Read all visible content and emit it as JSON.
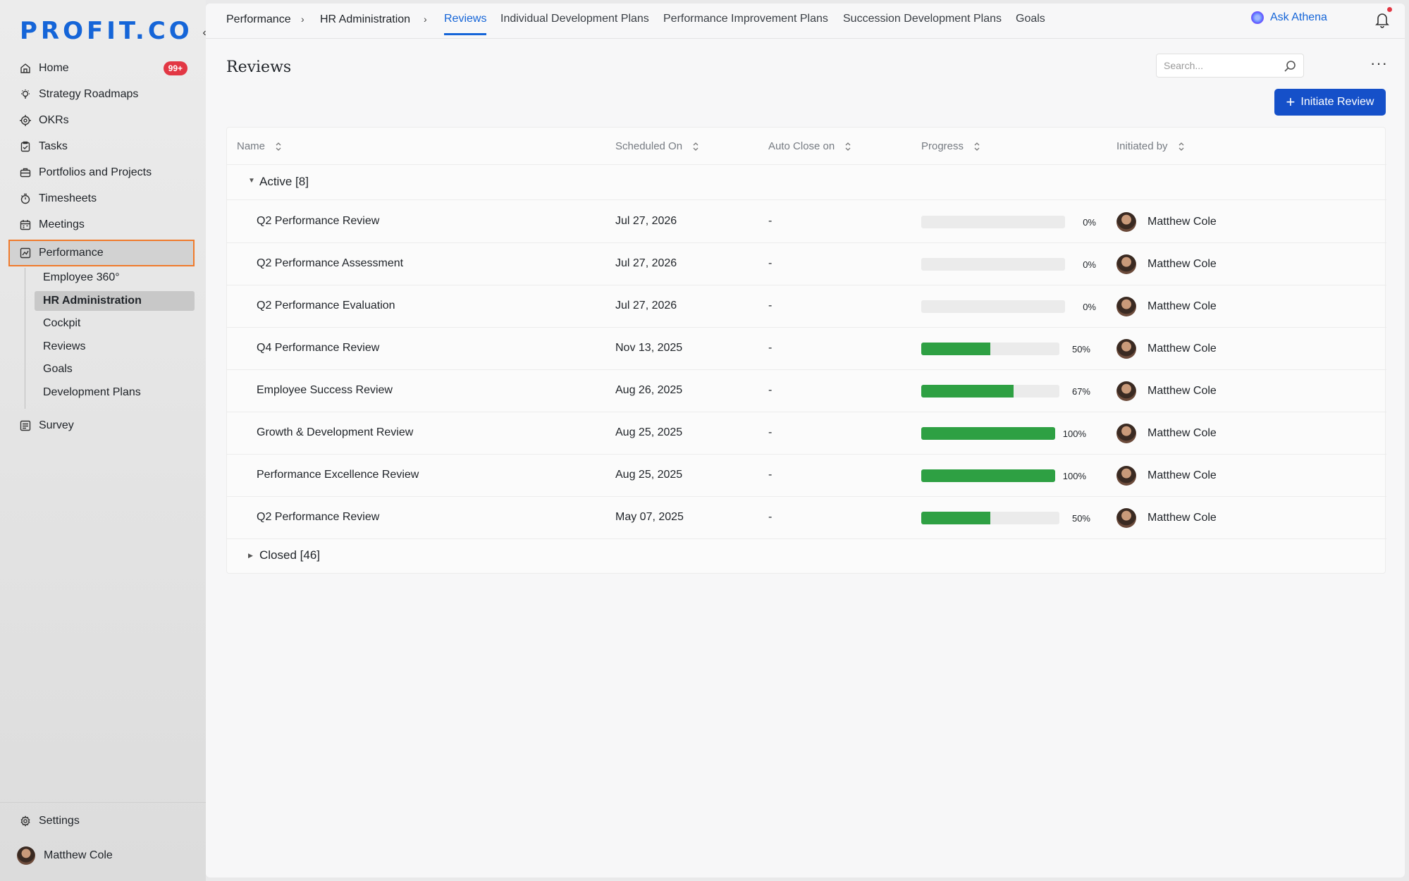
{
  "brand": {
    "logo_text": "PROFIT.CO"
  },
  "sidebar": {
    "collapse_label": "‹",
    "items": [
      {
        "label": "Home",
        "icon": "home-icon",
        "badge": "99+"
      },
      {
        "label": "Strategy Roadmaps",
        "icon": "lightbulb-icon"
      },
      {
        "label": "OKRs",
        "icon": "target-icon"
      },
      {
        "label": "Tasks",
        "icon": "clipboard-check-icon"
      },
      {
        "label": "Portfolios and Projects",
        "icon": "briefcase-icon"
      },
      {
        "label": "Timesheets",
        "icon": "stopwatch-icon"
      },
      {
        "label": "Meetings",
        "icon": "calendar-icon"
      },
      {
        "label": "Performance",
        "icon": "chart-line-icon"
      },
      {
        "label": "Survey",
        "icon": "survey-icon"
      }
    ],
    "performance_sub": [
      {
        "label": "Employee 360°"
      },
      {
        "label": "HR Administration"
      },
      {
        "label": "Cockpit"
      },
      {
        "label": "Reviews"
      },
      {
        "label": "Goals"
      },
      {
        "label": "Development Plans"
      }
    ],
    "settings_label": "Settings",
    "user_name": "Matthew Cole"
  },
  "topbar": {
    "breadcrumb": [
      "Performance",
      "HR Administration"
    ],
    "breadcrumb_sep": "›",
    "tabs": [
      "Reviews",
      "Individual Development Plans",
      "Performance Improvement Plans",
      "Succession Development Plans",
      "Goals"
    ],
    "active_tab": "Reviews",
    "ask_label": "Ask Athena"
  },
  "page": {
    "title": "Reviews",
    "search_placeholder": "Search...",
    "more_label": "···",
    "primary_button": "Initiate Review"
  },
  "table": {
    "columns": [
      "Name",
      "Scheduled On",
      "Auto Close on",
      "Progress",
      "Initiated by"
    ],
    "groups": {
      "active_label": "Active",
      "active_count": "[8]",
      "closed_label": "Closed",
      "closed_count": "[46]"
    },
    "rows": [
      {
        "name": "Q2 Performance Review",
        "scheduled": "Jul 27, 2026",
        "auto_close": "-",
        "progress": 0,
        "progress_text": "0%",
        "initiated_by": "Matthew Cole"
      },
      {
        "name": "Q2 Performance Assessment",
        "scheduled": "Jul 27, 2026",
        "auto_close": "-",
        "progress": 0,
        "progress_text": "0%",
        "initiated_by": "Matthew Cole"
      },
      {
        "name": "Q2 Performance Evaluation",
        "scheduled": "Jul 27, 2026",
        "auto_close": "-",
        "progress": 0,
        "progress_text": "0%",
        "initiated_by": "Matthew Cole"
      },
      {
        "name": "Q4 Performance Review",
        "scheduled": "Nov 13, 2025",
        "auto_close": "-",
        "progress": 50,
        "progress_text": "50%",
        "initiated_by": "Matthew Cole"
      },
      {
        "name": "Employee Success Review",
        "scheduled": "Aug 26, 2025",
        "auto_close": "-",
        "progress": 67,
        "progress_text": "67%",
        "initiated_by": "Matthew Cole"
      },
      {
        "name": "Growth & Development Review",
        "scheduled": "Aug 25, 2025",
        "auto_close": "-",
        "progress": 100,
        "progress_text": "100%",
        "initiated_by": "Matthew Cole"
      },
      {
        "name": "Performance Excellence Review",
        "scheduled": "Aug 25, 2025",
        "auto_close": "-",
        "progress": 100,
        "progress_text": "100%",
        "initiated_by": "Matthew Cole"
      },
      {
        "name": "Q2 Performance Review",
        "scheduled": "May 07, 2025",
        "auto_close": "-",
        "progress": 50,
        "progress_text": "50%",
        "initiated_by": "Matthew Cole"
      }
    ]
  },
  "colors": {
    "accent": "#1565d8",
    "primary_button": "#1550c9",
    "progress_fill": "#2ea043",
    "badge": "#e23744",
    "selected_outline": "#f07a2b"
  }
}
